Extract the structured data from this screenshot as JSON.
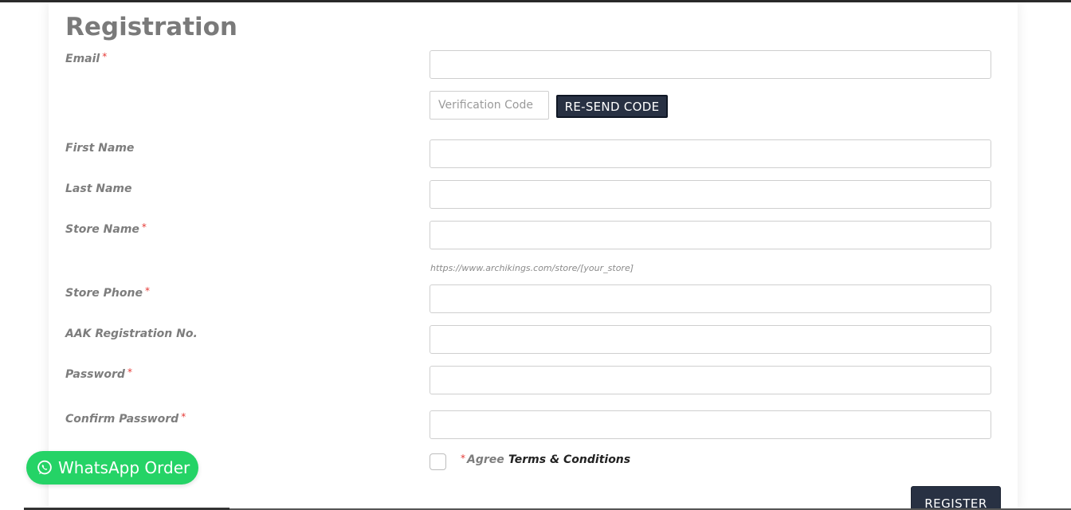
{
  "page": {
    "title": "Registration"
  },
  "form": {
    "email_label": "Email",
    "verification_placeholder": "Verification Code",
    "resend_label": "RE-SEND CODE",
    "first_name_label": "First Name",
    "last_name_label": "Last Name",
    "store_name_label": "Store Name",
    "store_url_hint": "https://www.archikings.com/store/[your_store]",
    "store_phone_label": "Store Phone",
    "aak_label": "AAK Registration No.",
    "password_label": "Password",
    "confirm_password_label": "Confirm Password",
    "agree_label": "Agree",
    "terms_link": "Terms & Conditions",
    "register_label": "REGISTER",
    "required_marker": "*"
  },
  "whatsapp": {
    "label": "WhatsApp Order"
  },
  "colors": {
    "accent_dark": "#283143",
    "whatsapp_green": "#25d366",
    "required_red": "#e53935"
  }
}
